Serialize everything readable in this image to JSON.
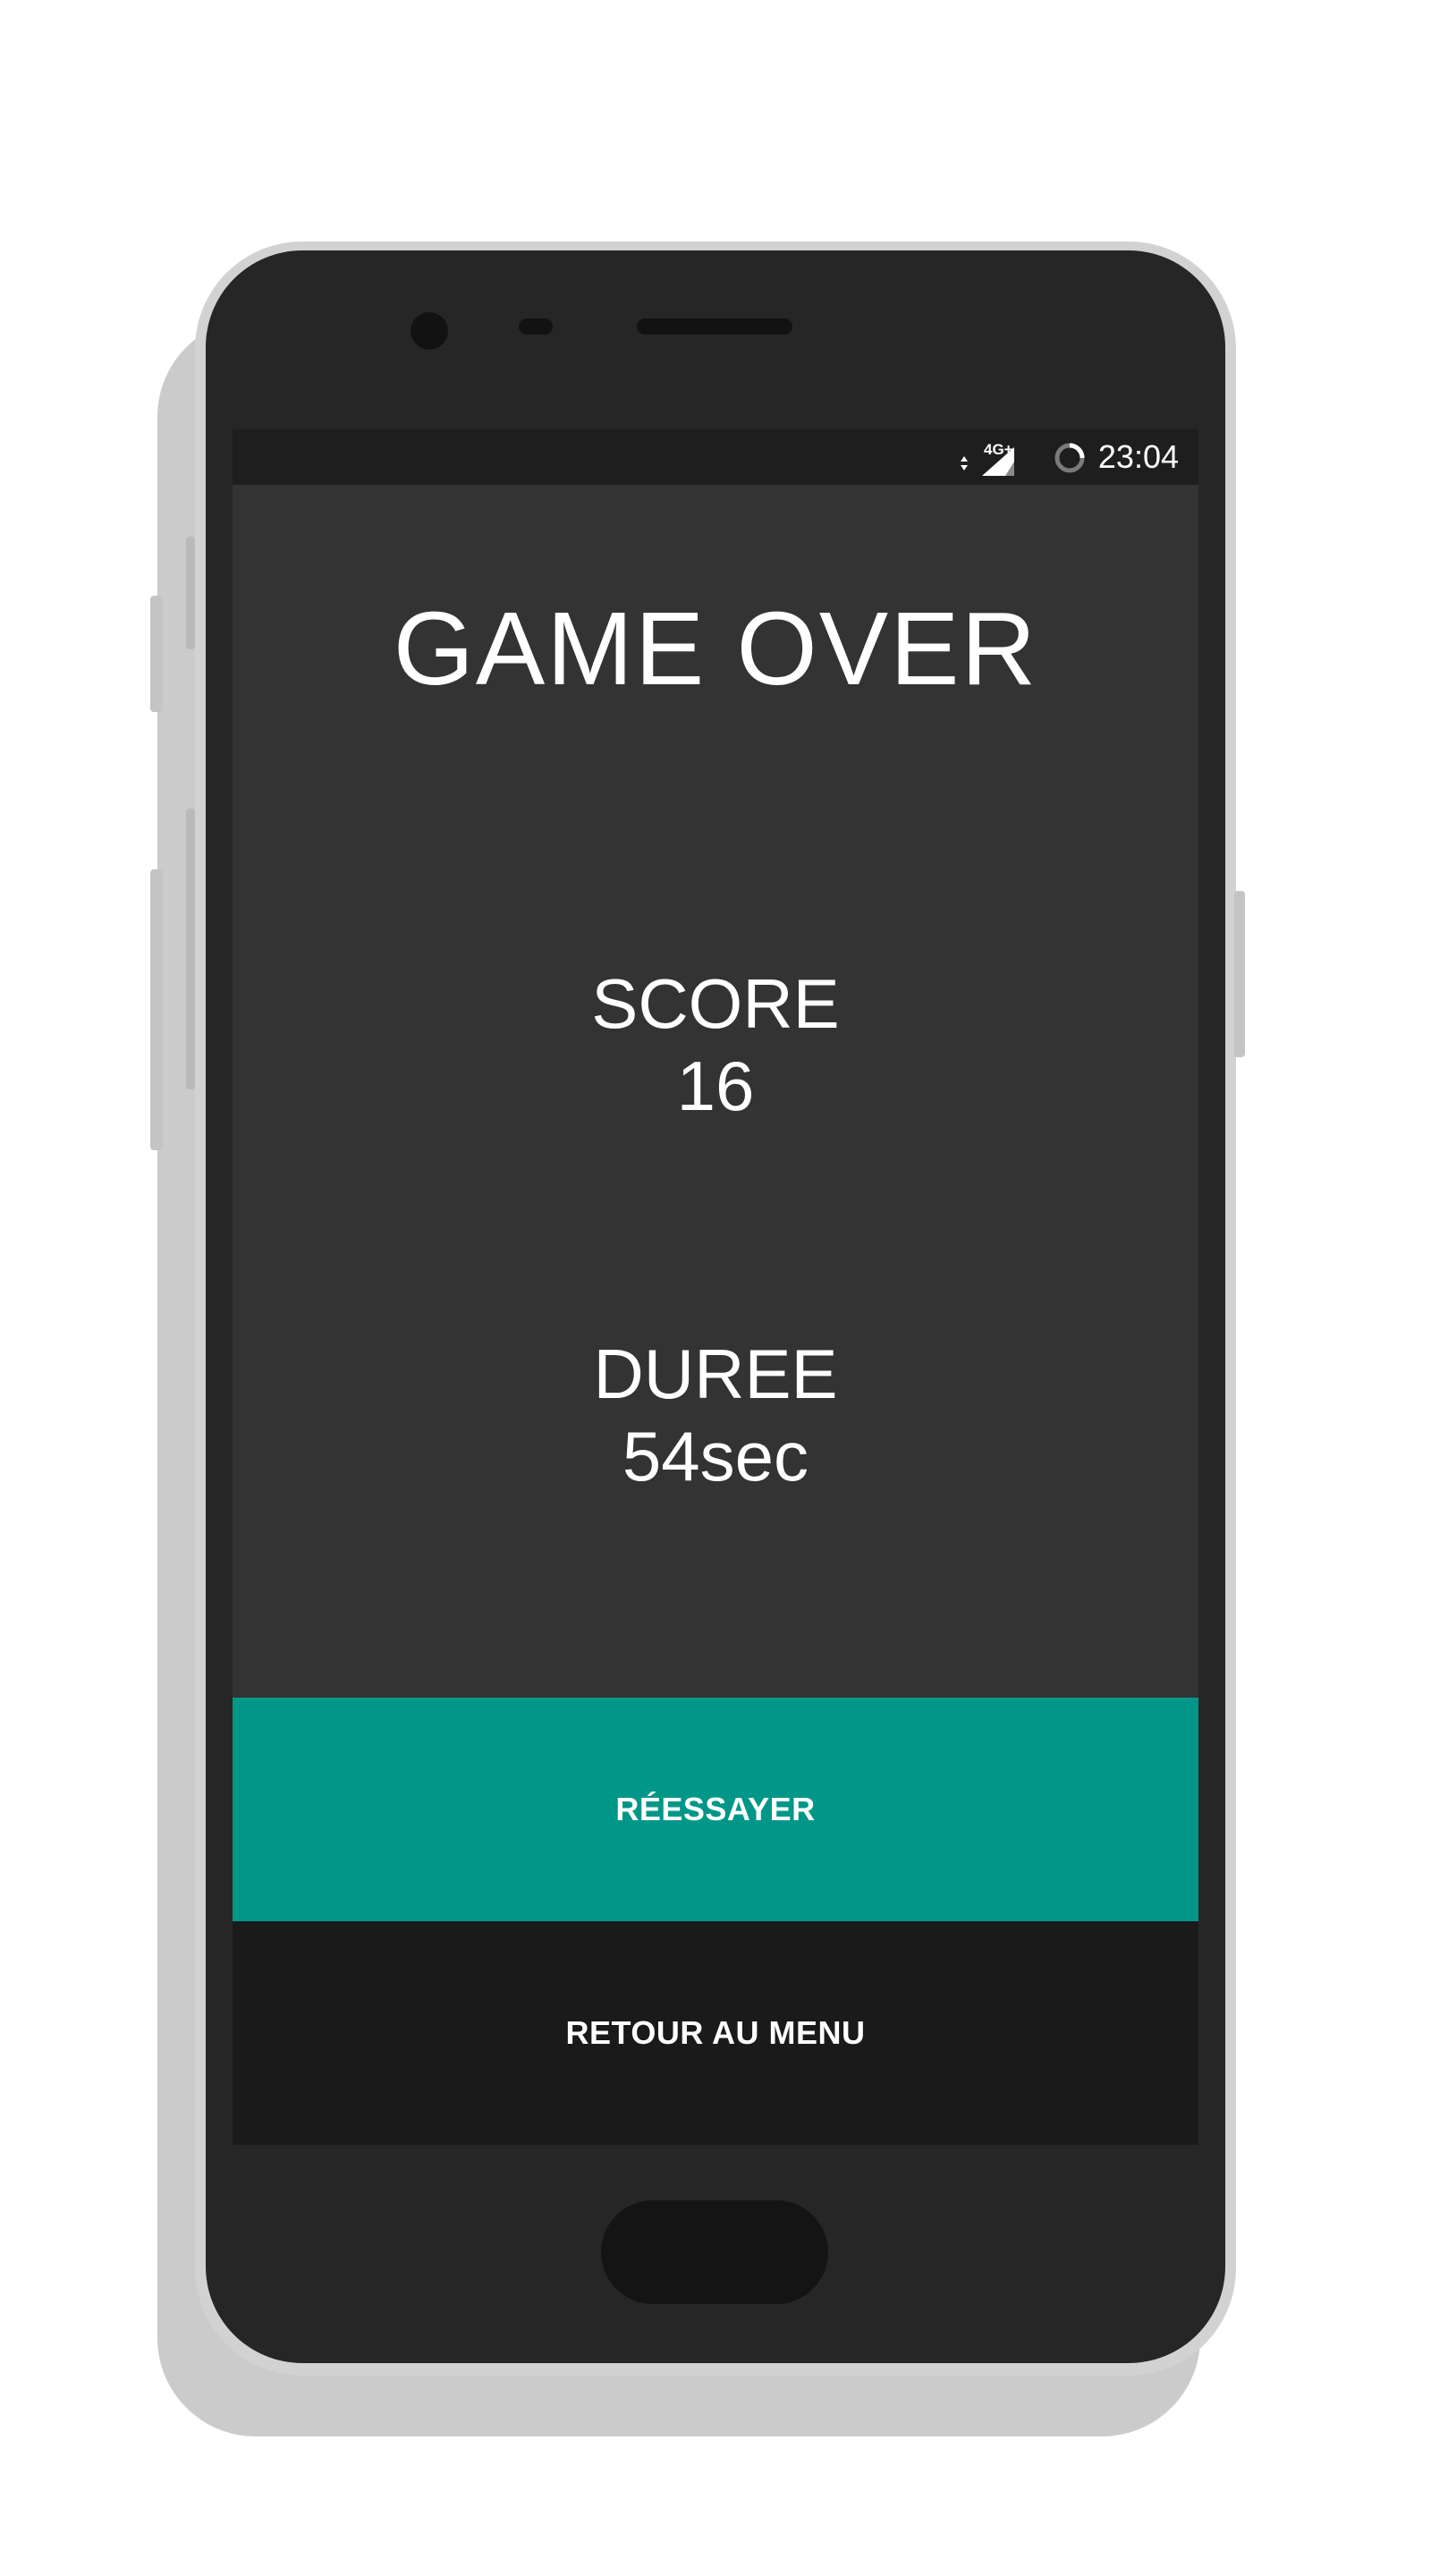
{
  "colors": {
    "screen_background": "#333333",
    "status_bar_background": "#1e1e1e",
    "retry_button": "#009788",
    "menu_button": "#1a1a1a",
    "text": "#ffffff",
    "phone_body": "#262626",
    "phone_frame": "#d2d2d2"
  },
  "status_bar": {
    "time": "23:04",
    "network": "4G+",
    "icons": [
      "data-arrows-icon",
      "signal-icon",
      "loading-icon"
    ]
  },
  "game_over": {
    "title": "GAME OVER",
    "score_label": "SCORE",
    "score_value": "16",
    "duration_label": "DUREE",
    "duration_value": "54sec"
  },
  "buttons": {
    "retry_label": "RÉESSAYER",
    "menu_label": "RETOUR AU MENU"
  }
}
